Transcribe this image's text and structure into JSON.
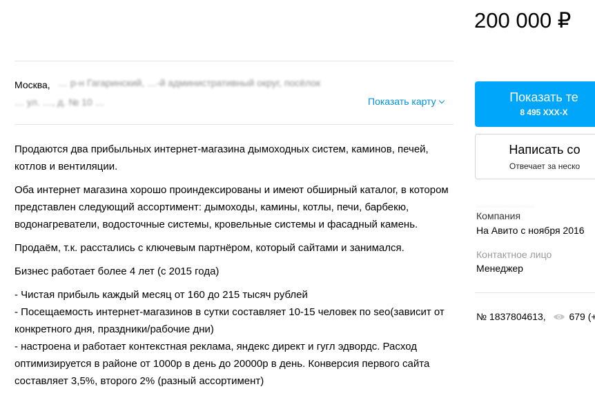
{
  "price": "200 000 ₽",
  "address": {
    "city": "Москва,",
    "line1_rest": "… р-н Гагаринский, …-й административный округ, посёлок",
    "line2": "… ул. …, д. № 10 …",
    "map_link": "Показать карту"
  },
  "description": [
    "Продаются два прибыльных интернет-магазина дымоходных систем, каминов, печей, котлов и вентиляции.",
    "Оба интернет магазина хорошо проиндексированы и имеют обширный каталог, в котором представлен следующий ассортимент: дымоходы, камины, котлы, печи, барбекю, водонагреватели, водосточные системы, кровельные системы и фасадный камень.",
    "Продаём, т.к. расстались с ключевым партнёром, который сайтами и занимался.",
    "Бизнес работает более 4 лет (с 2015 года)",
    "- Чистая прибыль каждый месяц от 160 до 215 тысяч рублей\n- Посещаемость интернет-магазинов в сутки составляет 10-15 человек по seo(зависит от конкретного дня, праздники/рабочие дни)\n- настроена и работает контекстная реклама, яндекс директ и гугл эдвордс. Расход оптимизируется в районе от 1000р в день до 20000р в день. Конверсия первого сайта составляет 3,5%, второго 2% (разный ассортимент)"
  ],
  "call_button": {
    "label": "Показать те",
    "phone": "8 495 XXX-X"
  },
  "message_button": {
    "label": "Написать со",
    "sub": "Отвечает за неско"
  },
  "seller": {
    "blurred_name": "…………………",
    "type": "Компания",
    "since": "На Авито с ноября 2016"
  },
  "contact": {
    "label": "Контактное лицо",
    "value": "Менеджер"
  },
  "listing": {
    "number": "№ 1837804613,",
    "views": "679 (+"
  },
  "colors": {
    "accent": "#00a6f9",
    "link": "#0091d9"
  }
}
